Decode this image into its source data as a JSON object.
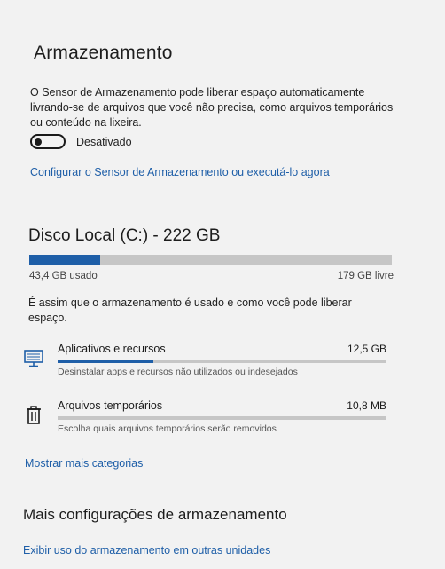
{
  "storage_sense": {
    "title": "Armazenamento",
    "description": "O Sensor de Armazenamento pode liberar espaço automaticamente livrando-se de arquivos que você não precisa, como arquivos temporários ou conteúdo na lixeira.",
    "toggle_state_label": "Desativado",
    "toggle_on": false,
    "configure_link": "Configurar o Sensor de Armazenamento ou executá-lo agora"
  },
  "disk": {
    "title": "Disco Local (C:) - 222 GB",
    "used_label": "43,4 GB usado",
    "free_label": "179 GB livre",
    "used_fraction": 0.195,
    "usage_description": "É assim que o armazenamento é usado e como você pode liberar espaço."
  },
  "categories": [
    {
      "icon": "monitor-icon",
      "name": "Aplicativos e recursos",
      "size": "12,5 GB",
      "fraction": 0.29,
      "subtitle": "Desinstalar apps e recursos não utilizados ou indesejados"
    },
    {
      "icon": "trash-icon",
      "name": "Arquivos temporários",
      "size": "10,8 MB",
      "fraction": 0.0,
      "subtitle": "Escolha quais arquivos temporários serão removidos"
    }
  ],
  "show_more_link": "Mostrar mais categorias",
  "more_settings": {
    "title": "Mais configurações de armazenamento",
    "other_drives_link": "Exibir uso do armazenamento em outras unidades"
  },
  "colors": {
    "accent": "#1f5fa8",
    "bar_track": "#c6c6c6",
    "background": "#f2f2f2"
  }
}
